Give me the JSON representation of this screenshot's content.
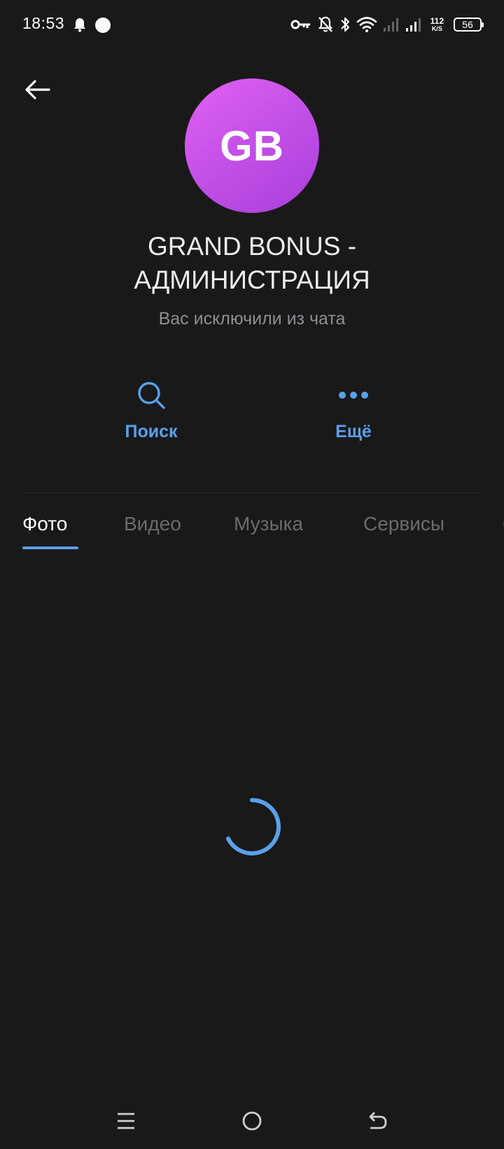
{
  "status_bar": {
    "time": "18:53",
    "net_speed_value": "112",
    "net_speed_unit": "K/S",
    "battery_level": "56",
    "icons": [
      "bell-icon",
      "circle-notification-icon",
      "key-icon",
      "bell-off-icon",
      "bluetooth-icon",
      "wifi-icon",
      "signal-icon",
      "signal-icon",
      "battery-icon"
    ]
  },
  "header": {
    "back_icon": "arrow-left-icon"
  },
  "profile": {
    "avatar_initials": "GB",
    "avatar_color": "#c04ee6",
    "name": "GRAND BONUS - АДМИНИСТРАЦИЯ",
    "status": "Вас исключили из чата"
  },
  "actions": {
    "search_label": "Поиск",
    "more_label": "Ещё",
    "accent_color": "#5aa0ea"
  },
  "tabs": {
    "items": [
      {
        "label": "Фото",
        "active": true
      },
      {
        "label": "Видео",
        "active": false
      },
      {
        "label": "Музыка",
        "active": false
      },
      {
        "label": "Сервисы",
        "active": false
      }
    ]
  },
  "content": {
    "loading": true
  },
  "nav_bar": {
    "icons": [
      "menu-icon",
      "home-icon",
      "back-icon"
    ]
  }
}
